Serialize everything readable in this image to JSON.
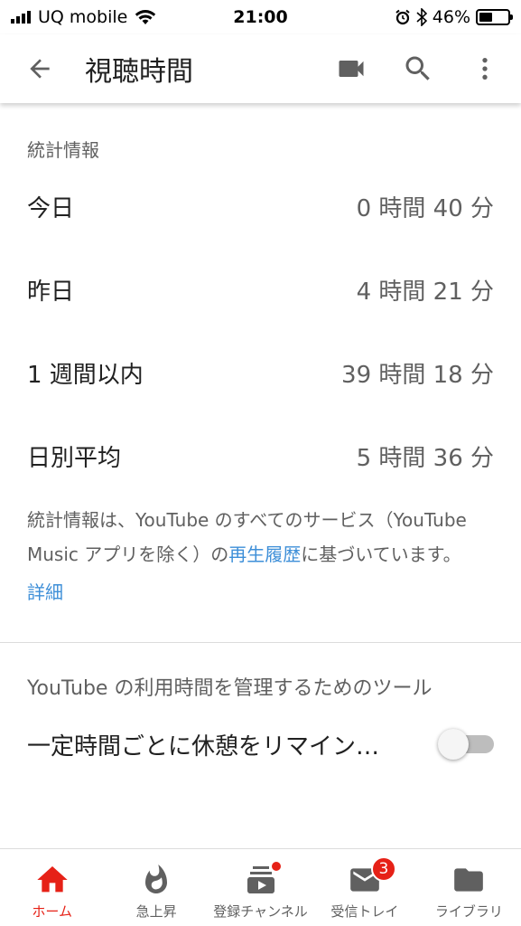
{
  "status_bar": {
    "carrier": "UQ mobile",
    "time": "21:00",
    "battery_percent": "46%",
    "battery_level": 0.46
  },
  "app_bar": {
    "title": "視聴時間",
    "icons": [
      "back-arrow-icon",
      "video-camera-icon",
      "search-icon",
      "more-vert-icon"
    ]
  },
  "stats": {
    "section_title": "統計情報",
    "rows": [
      {
        "label": "今日",
        "value": "0 時間 40 分"
      },
      {
        "label": "昨日",
        "value": "4 時間 21 分"
      },
      {
        "label": "1 週間以内",
        "value": "39 時間 18 分"
      },
      {
        "label": "日別平均",
        "value": "5 時間 36 分"
      }
    ],
    "note_before": "統計情報は、YouTube のすべてのサービス（YouTube Music アプリを除く）の",
    "note_link": "再生履歴",
    "note_after": "に基づいています。",
    "details_link": "詳細"
  },
  "tools": {
    "section_title": "YouTube の利用時間を管理するためのツール",
    "break_reminder_label": "一定時間ごとに休憩をリマイン…",
    "break_reminder_on": false
  },
  "bottom_nav": {
    "items": [
      {
        "label": "ホーム",
        "icon": "home-icon",
        "active": true
      },
      {
        "label": "急上昇",
        "icon": "flame-icon",
        "active": false
      },
      {
        "label": "登録チャンネル",
        "icon": "subscriptions-icon",
        "active": false
      },
      {
        "label": "受信トレイ",
        "icon": "mail-icon",
        "active": false,
        "badge": "3"
      },
      {
        "label": "ライブラリ",
        "icon": "folder-icon",
        "active": false
      }
    ]
  },
  "colors": {
    "accent_red": "#e62117",
    "link_blue": "#3e8fd8",
    "secondary_text": "#606060"
  }
}
